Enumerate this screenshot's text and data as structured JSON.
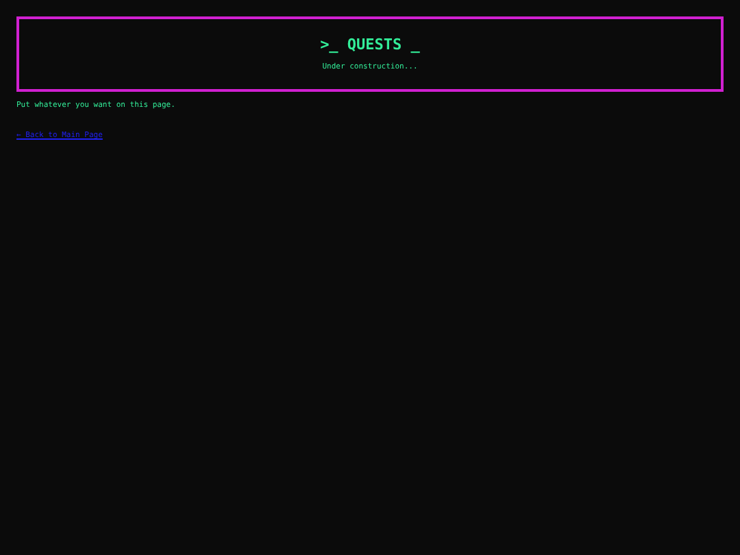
{
  "header": {
    "title": ">_ QUESTS _",
    "subtitle": "Under construction..."
  },
  "body_text": "Put whatever you want on this page.",
  "back_link": "← Back to Main Page"
}
